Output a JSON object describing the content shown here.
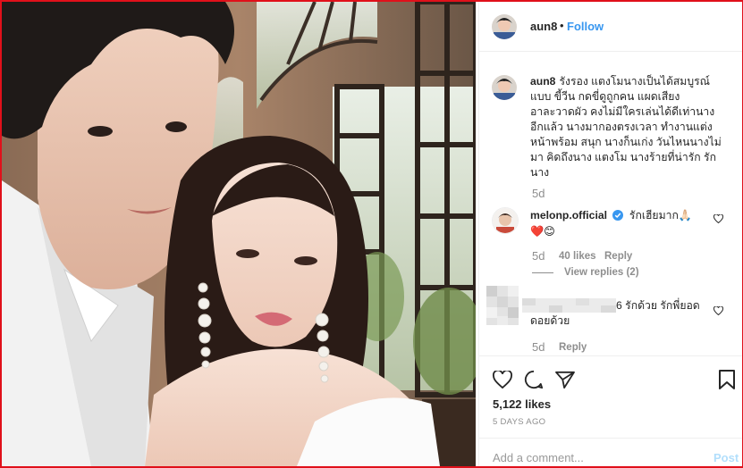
{
  "post": {
    "author": "aun8",
    "separator": "•",
    "follow_label": "Follow",
    "caption_author": "aun8",
    "caption_lines": [
      "รังรอง แตงโมนางเป็นได้สมบูรณ์",
      "แบบ ขี้วีน กดขี่ดูถูกคน แผดเสียง",
      "อาละวาดผัว คงไม่มีใครเล่นได้ดีเท่านาง",
      "อีกแล้ว นางมากองตรงเวลา ทำงานแต่ง",
      "หน้าพร้อม สนุก นางก็นเก่ง วันไหนนางไม่",
      "มา คิดถึงนาง แตงโม นางร้ายที่น่ารัก รัก",
      "นาง"
    ],
    "caption_time": "5d"
  },
  "comments": [
    {
      "username": "melonp.official",
      "verified": true,
      "text": "รักเฮียมาก🙏🏻",
      "emoji_line": "❤️😊",
      "time": "5d",
      "likes": "40 likes",
      "reply_label": "Reply",
      "view_replies": "View replies (2)"
    },
    {
      "username": "",
      "text_line1": "6 รักด้วย รักพี่ยอด",
      "text_line2": "ดอยด้วย",
      "time": "5d",
      "reply_label": "Reply"
    }
  ],
  "actions": {
    "likes": "5,122 likes",
    "date": "5 DAYS AGO"
  },
  "add_comment": {
    "placeholder": "Add a comment...",
    "post_label": "Post"
  },
  "colors": {
    "accent": "#3897f0",
    "border": "#e0101a",
    "heart": "#ed4956",
    "verified": "#3897f0"
  }
}
